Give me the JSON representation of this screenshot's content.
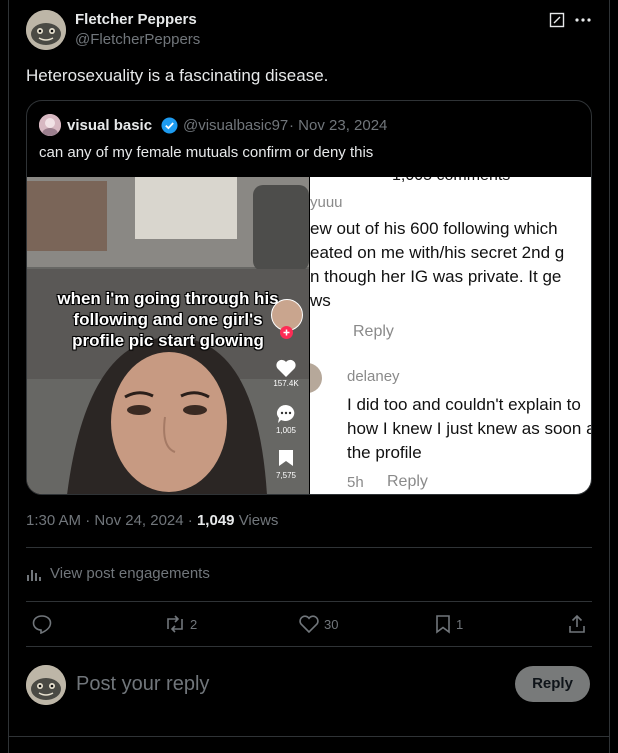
{
  "post": {
    "author_name": "Fletcher Peppers",
    "author_handle": "@FletcherPeppers",
    "text": "Heterosexuality is a fascinating disease.",
    "time": "1:30 AM",
    "sep": "·",
    "date": "Nov 24, 2024",
    "views_count": "1,049",
    "views_label": "Views"
  },
  "quote": {
    "author_name": "visual basic",
    "author_handle": "@visualbasic97",
    "date": "· Nov 23, 2024",
    "text": "can any of my female mutuals confirm or deny this"
  },
  "media_left": {
    "caption_lines": [
      "when i'm going through his",
      "following and one girl's",
      "profile pic start glowing"
    ],
    "likes": "157.4K",
    "comments": "1,005",
    "saves": "7,575"
  },
  "media_right": {
    "header": "1,005 comments",
    "c1_user": "yuuu",
    "c1_lines": [
      "ew out of his 600 following which",
      "eated on me with/his secret 2nd g",
      "n though her IG was private. It ge",
      "ws"
    ],
    "c1_reply": "Reply",
    "c2_user": "delaney",
    "c2_lines": [
      "I did too and couldn't explain to",
      "how I knew I just knew as soon a",
      "the profile"
    ],
    "c2_time": "5h",
    "c2_reply": "Reply"
  },
  "engagements": "View post engagements",
  "actions": {
    "retweets": "2",
    "likes": "30",
    "bookmarks": "1"
  },
  "composer": {
    "placeholder": "Post your reply",
    "button": "Reply"
  }
}
